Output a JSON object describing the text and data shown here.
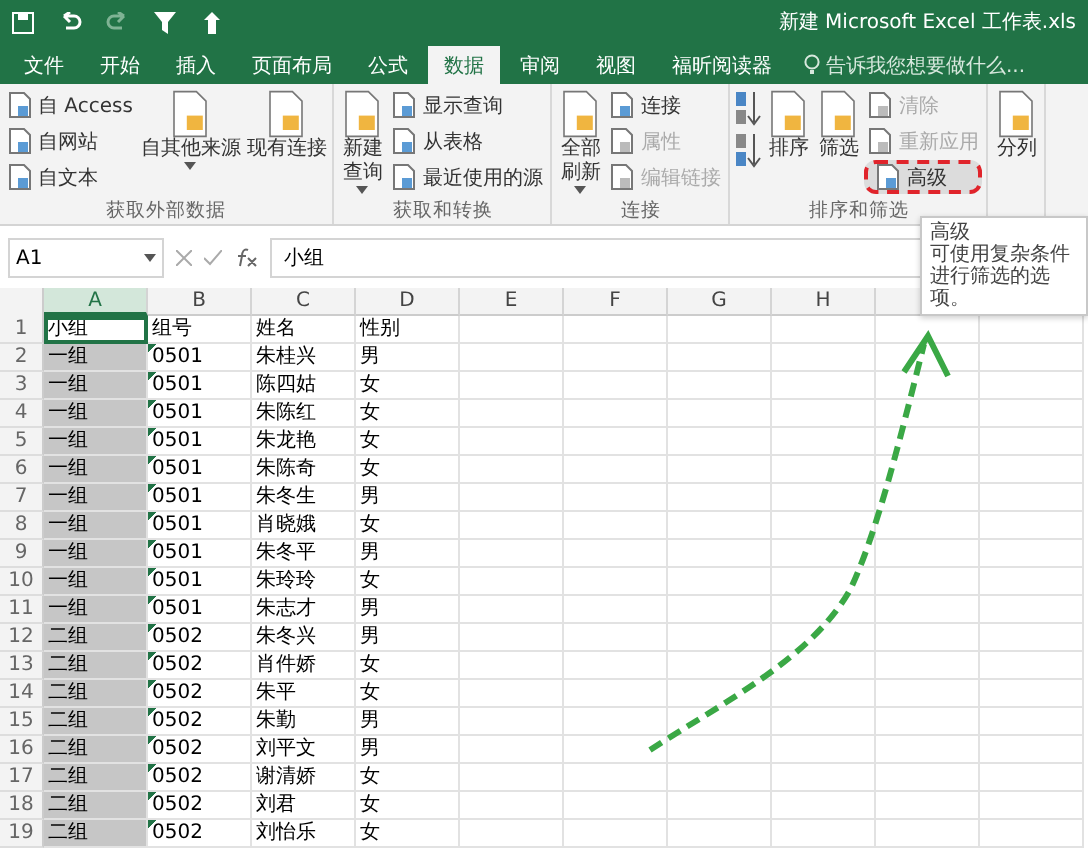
{
  "window": {
    "title": "新建 Microsoft Excel 工作表.xls"
  },
  "tabs": [
    {
      "label": "文件",
      "selected": false
    },
    {
      "label": "开始",
      "selected": false
    },
    {
      "label": "插入",
      "selected": false
    },
    {
      "label": "页面布局",
      "selected": false
    },
    {
      "label": "公式",
      "selected": false
    },
    {
      "label": "数据",
      "selected": true
    },
    {
      "label": "审阅",
      "selected": false
    },
    {
      "label": "视图",
      "selected": false
    },
    {
      "label": "福昕阅读器",
      "selected": false
    }
  ],
  "search": {
    "placeholder": "告诉我您想要做什么..."
  },
  "ribbon": [
    {
      "label": "获取外部数据",
      "columns": [
        [
          {
            "kind": "small",
            "label": "自 Access",
            "disabled": false
          },
          {
            "kind": "small",
            "label": "自网站",
            "disabled": false
          },
          {
            "kind": "small",
            "label": "自文本",
            "disabled": false
          }
        ],
        [
          {
            "kind": "large",
            "label": "自其他来源",
            "dropdown": true,
            "disabled": false
          }
        ],
        [
          {
            "kind": "large",
            "label": "现有连接",
            "dropdown": false,
            "disabled": false
          }
        ]
      ]
    },
    {
      "label": "获取和转换",
      "columns": [
        [
          {
            "kind": "large",
            "label": "新建查询",
            "dropdown": true,
            "disabled": false
          }
        ],
        [
          {
            "kind": "small",
            "label": "显示查询",
            "disabled": false
          },
          {
            "kind": "small",
            "label": "从表格",
            "disabled": false
          },
          {
            "kind": "small",
            "label": "最近使用的源",
            "disabled": false
          }
        ]
      ]
    },
    {
      "label": "连接",
      "columns": [
        [
          {
            "kind": "large",
            "label": "全部刷新",
            "dropdown": true,
            "disabled": false
          }
        ],
        [
          {
            "kind": "small",
            "label": "连接",
            "disabled": false
          },
          {
            "kind": "small",
            "label": "属性",
            "disabled": true
          },
          {
            "kind": "small",
            "label": "编辑链接",
            "disabled": true
          }
        ]
      ]
    },
    {
      "label": "排序和筛选",
      "columns": [
        [
          {
            "kind": "icon"
          },
          {
            "kind": "icon"
          }
        ],
        [
          {
            "kind": "large",
            "label": "排序",
            "dropdown": false,
            "disabled": false
          }
        ],
        [
          {
            "kind": "large",
            "label": "筛选",
            "dropdown": false,
            "disabled": false
          }
        ],
        [
          {
            "kind": "small",
            "label": "清除",
            "disabled": true
          },
          {
            "kind": "small",
            "label": "重新应用",
            "disabled": true
          },
          {
            "kind": "small",
            "label": "高级",
            "disabled": false,
            "highlighted": true
          }
        ]
      ]
    },
    {
      "columns": [
        [
          {
            "kind": "large",
            "label": "分列",
            "dropdown": false,
            "disabled": false
          }
        ]
      ]
    }
  ],
  "formula_bar": {
    "name_box": "A1",
    "content": "小组"
  },
  "columns": [
    {
      "label": "A",
      "selected": true
    },
    {
      "label": "B",
      "selected": false
    },
    {
      "label": "C",
      "selected": false
    },
    {
      "label": "D",
      "selected": false
    },
    {
      "label": "E",
      "selected": false
    },
    {
      "label": "F",
      "selected": false
    },
    {
      "label": "G",
      "selected": false
    },
    {
      "label": "H",
      "selected": false
    }
  ],
  "rows": [
    {
      "number": "1",
      "cells": [
        "小组",
        "组号",
        "姓名",
        "性别"
      ]
    },
    {
      "number": "2",
      "cells": [
        "一组",
        "0501",
        "朱桂兴",
        "男"
      ]
    },
    {
      "number": "3",
      "cells": [
        "一组",
        "0501",
        "陈四姑",
        "女"
      ]
    },
    {
      "number": "4",
      "cells": [
        "一组",
        "0501",
        "朱陈红",
        "女"
      ]
    },
    {
      "number": "5",
      "cells": [
        "一组",
        "0501",
        "朱龙艳",
        "女"
      ]
    },
    {
      "number": "6",
      "cells": [
        "一组",
        "0501",
        "朱陈奇",
        "女"
      ]
    },
    {
      "number": "7",
      "cells": [
        "一组",
        "0501",
        "朱冬生",
        "男"
      ]
    },
    {
      "number": "8",
      "cells": [
        "一组",
        "0501",
        "肖晓娥",
        "女"
      ]
    },
    {
      "number": "9",
      "cells": [
        "一组",
        "0501",
        "朱冬平",
        "男"
      ]
    },
    {
      "number": "10",
      "cells": [
        "一组",
        "0501",
        "朱玲玲",
        "女"
      ]
    },
    {
      "number": "11",
      "cells": [
        "一组",
        "0501",
        "朱志才",
        "男"
      ]
    },
    {
      "number": "12",
      "cells": [
        "二组",
        "0502",
        "朱冬兴",
        "男"
      ]
    },
    {
      "number": "13",
      "cells": [
        "二组",
        "0502",
        "肖件娇",
        "女"
      ]
    },
    {
      "number": "14",
      "cells": [
        "二组",
        "0502",
        "朱平",
        "女"
      ]
    },
    {
      "number": "15",
      "cells": [
        "二组",
        "0502",
        "朱勤",
        "男"
      ]
    },
    {
      "number": "16",
      "cells": [
        "二组",
        "0502",
        "刘平文",
        "男"
      ]
    },
    {
      "number": "17",
      "cells": [
        "二组",
        "0502",
        "谢清娇",
        "女"
      ]
    },
    {
      "number": "18",
      "cells": [
        "二组",
        "0502",
        "刘君",
        "女"
      ]
    },
    {
      "number": "19",
      "cells": [
        "二组",
        "0502",
        "刘怡乐",
        "女"
      ]
    }
  ],
  "tooltip": {
    "title": "高级",
    "text": "可使用复杂条件进行筛选的选项。"
  }
}
